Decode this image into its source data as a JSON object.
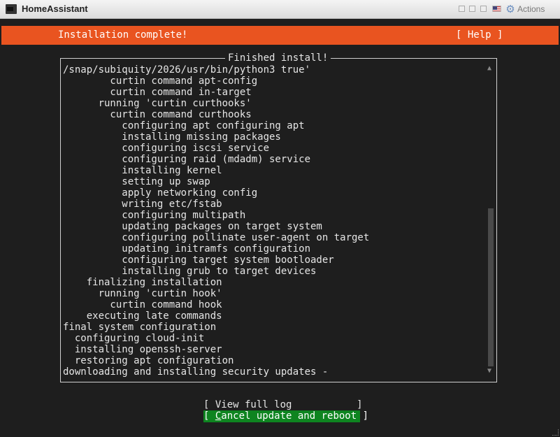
{
  "window": {
    "title": "HomeAssistant",
    "actions_label": "Actions"
  },
  "header": {
    "title": "Installation complete!",
    "help_label": "[ Help ]",
    "accent_color": "#e95420"
  },
  "log": {
    "frame_title": "Finished install!",
    "lines": [
      "/snap/subiquity/2026/usr/bin/python3 true'",
      "        curtin command apt-config",
      "        curtin command in-target",
      "      running 'curtin curthooks'",
      "        curtin command curthooks",
      "          configuring apt configuring apt",
      "          installing missing packages",
      "          configuring iscsi service",
      "          configuring raid (mdadm) service",
      "          installing kernel",
      "          setting up swap",
      "          apply networking config",
      "          writing etc/fstab",
      "          configuring multipath",
      "          updating packages on target system",
      "          configuring pollinate user-agent on target",
      "          updating initramfs configuration",
      "          configuring target system bootloader",
      "          installing grub to target devices",
      "    finalizing installation",
      "      running 'curtin hook'",
      "        curtin command hook",
      "    executing late commands",
      "final system configuration",
      "  configuring cloud-init",
      "  installing openssh-server",
      "  restoring apt configuration",
      "downloading and installing security updates -"
    ]
  },
  "buttons": {
    "view_log": "[ View full log           ]",
    "cancel_reboot_open": "[ ",
    "cancel_reboot_accel": "C",
    "cancel_reboot_rest": "ancel update and reboot ]",
    "cancel_color": "#0e8420"
  },
  "icons": {
    "scroll_up": "▲",
    "scroll_down": "▼",
    "settings": "gear-icon",
    "language": "flag-icon"
  }
}
